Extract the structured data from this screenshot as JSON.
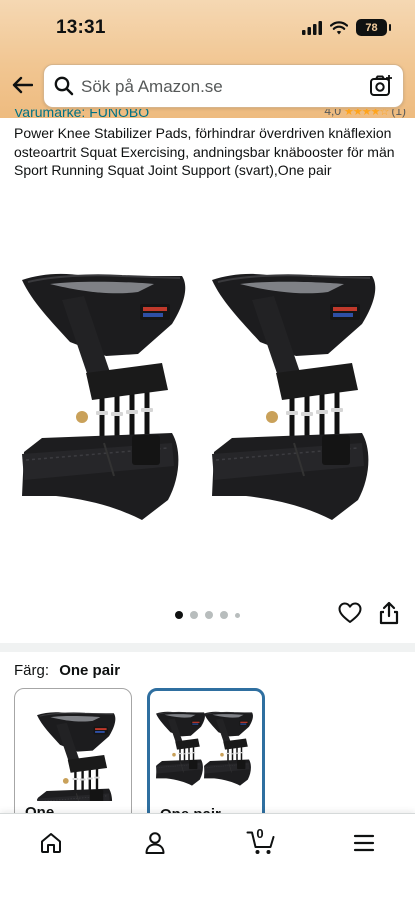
{
  "status_bar": {
    "time": "13:31",
    "battery": "78"
  },
  "search": {
    "placeholder": "Sök på Amazon.se"
  },
  "product": {
    "brand": "Varumärke: FUNOBO",
    "rating_value": "4,0",
    "rating_stars": "★★★★☆",
    "rating_count": "(1)",
    "title": "Power Knee Stabilizer Pads, förhindrar överdriven knäflexion osteoartrit Squat Exercising, andningsbar knäbooster för män Sport Running Squat Joint Support (svart),One pair",
    "image_count": 5,
    "active_image": 1
  },
  "variants": {
    "label": "Färg:",
    "selected": "One pair",
    "options": [
      {
        "caption": "One"
      },
      {
        "caption": "One pair"
      }
    ]
  },
  "nav": {
    "cart_count": "0",
    "items": [
      "home-icon",
      "account-icon",
      "cart-icon",
      "menu-icon"
    ]
  },
  "colors": {
    "accent": "#007185",
    "header": "#f1c692",
    "selected_border": "#2f6fa0"
  }
}
